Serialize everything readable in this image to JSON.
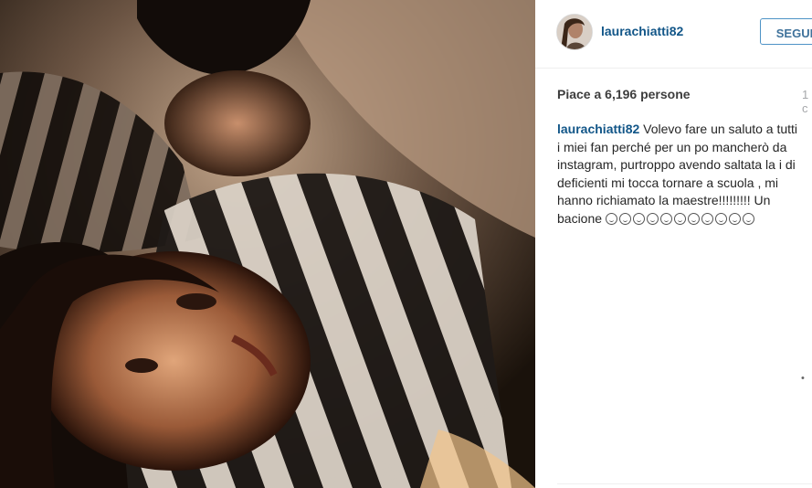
{
  "post": {
    "username": "laurachiatti82",
    "follow_label": "SEGUI",
    "likes_text": "Piace a 6,196 persone",
    "likes_edge": "1 c",
    "caption_user": "laurachiatti82",
    "caption_text": " Volevo fare un saluto a tutti i miei fan perché per un po mancherò da instagram, purtroppo avendo saltata la i di deficienti mi tocca tornare a scuola , mi hanno richiamato la maestre!!!!!!!!! Un bacione ",
    "caption_emoji_count": 11,
    "side_marker": "•"
  },
  "colors": {
    "link": "#125688",
    "follow_border": "#4e93c6",
    "text": "#262626"
  }
}
